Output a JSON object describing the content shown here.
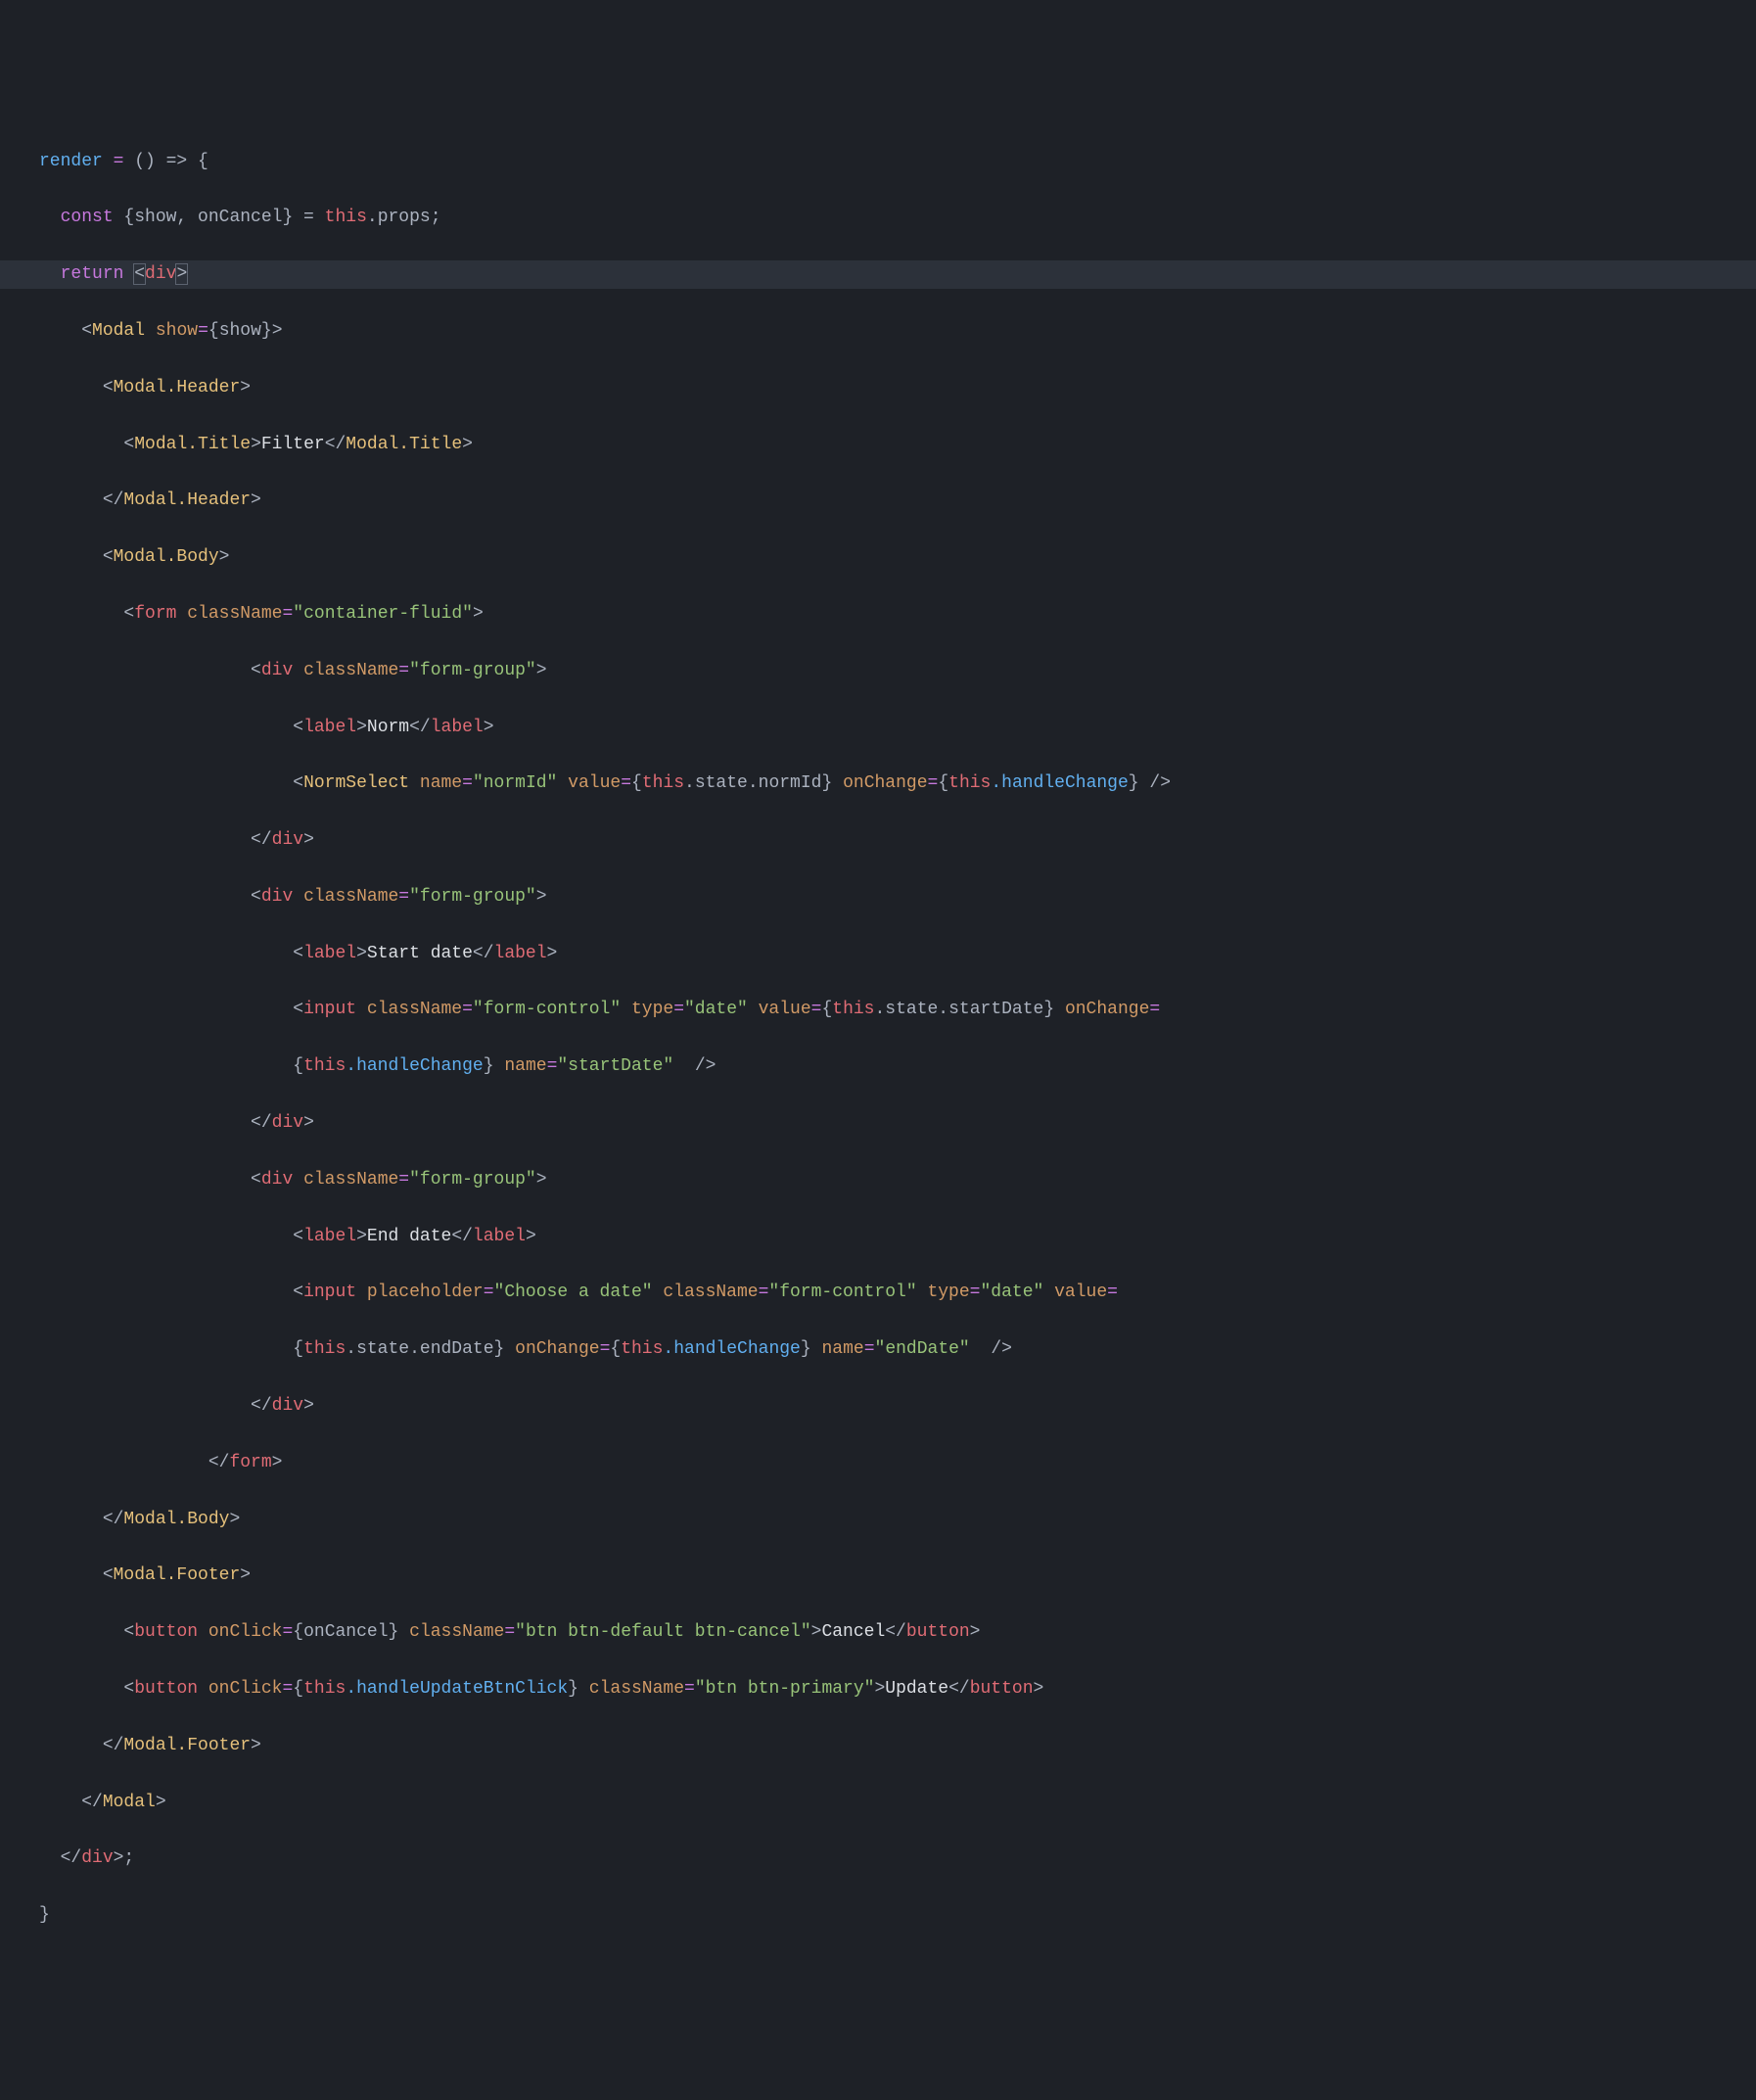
{
  "tokens": {
    "render": "render",
    "eq": " = ",
    "arrow": "() => {",
    "const": "const",
    "destruct": " {show, onCancel} = ",
    "this": "this",
    "dotProps": ".props;",
    "return": "return",
    "div_open_l": "<",
    "div": "div",
    "div_open_r": ">",
    "Modal": "Modal",
    "show_attr": "show",
    "show_val": "{show}",
    "ModalHeader": "Modal.Header",
    "ModalTitle": "Modal.Title",
    "Filter": "Filter",
    "ModalBody": "Modal.Body",
    "form": "form",
    "className": "className",
    "container_fluid": "\"container-fluid\"",
    "form_group": "\"form-group\"",
    "label": "label",
    "Norm": "Norm",
    "NormSelect": "NormSelect",
    "name_attr": "name",
    "normId_str": "\"normId\"",
    "value_attr": "value",
    "state": ".state.",
    "normId": "normId",
    "onChange": "onChange",
    "handleChange": ".handleChange",
    "StartDate": "Start date",
    "input": "input",
    "form_control": "\"form-control\"",
    "type_attr": "type",
    "date_str": "\"date\"",
    "startDate": "startDate",
    "startDate_str": "\"startDate\"",
    "EndDate": "End date",
    "placeholder_attr": "placeholder",
    "choose_date": "\"Choose a date\"",
    "endDate": "endDate",
    "endDate_str": "\"endDate\"",
    "ModalFooter": "Modal.Footer",
    "button": "button",
    "onClick": "onClick",
    "onCancel": "{onCancel}",
    "btn_default": "\"btn btn-default btn-cancel\"",
    "Cancel": "Cancel",
    "handleUpdateBtnClick": ".handleUpdateBtnClick",
    "btn_primary": "\"btn btn-primary\"",
    "Update": "Update"
  }
}
